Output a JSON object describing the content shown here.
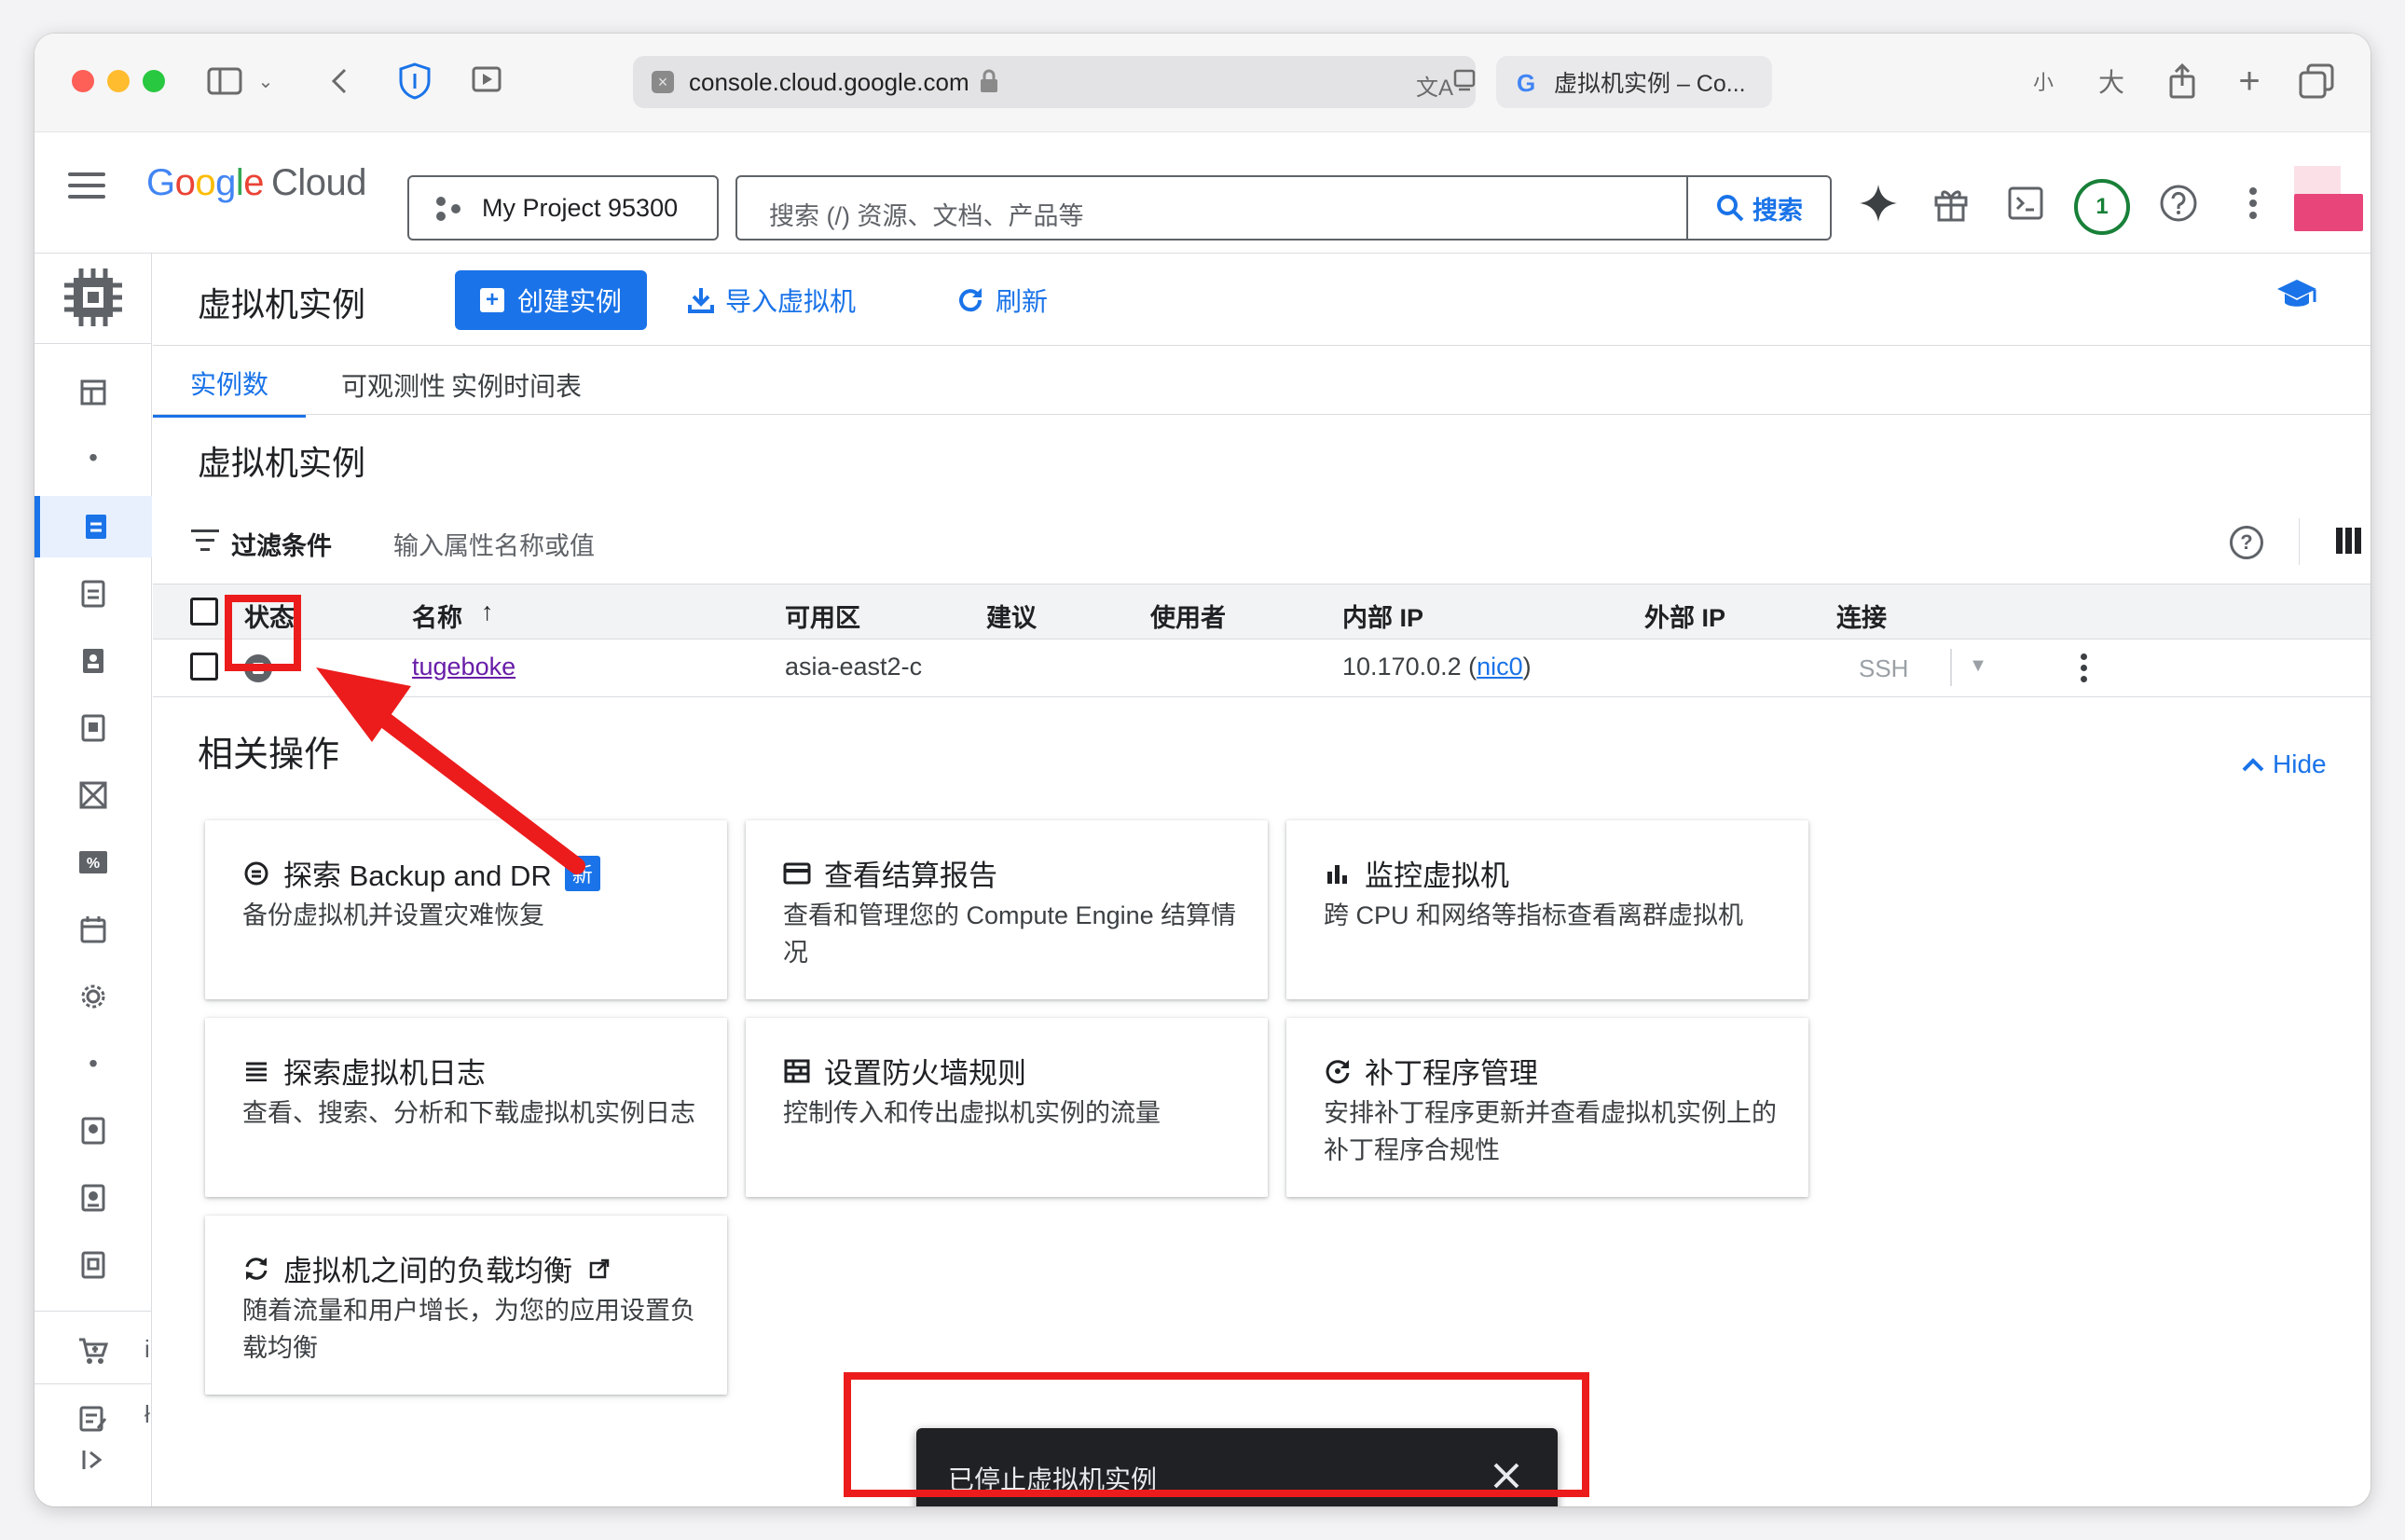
{
  "browser": {
    "url": "console.cloud.google.com",
    "tab_title": "虚拟机实例 – Co...",
    "text_small": "小",
    "text_large": "大"
  },
  "header": {
    "logo_google": "Google",
    "logo_cloud": "Cloud",
    "project": "My Project 95300",
    "search_placeholder": "搜索 (/) 资源、文档、产品等",
    "search_button": "搜索",
    "notifications_count": "1"
  },
  "toolbar": {
    "title": "虚拟机实例",
    "create_label": "创建实例",
    "import_label": "导入虚拟机",
    "refresh_label": "刷新"
  },
  "tabs": [
    {
      "label": "实例数",
      "active": true
    },
    {
      "label": "可观测性",
      "active": false
    },
    {
      "label": "实例时间表",
      "active": false
    }
  ],
  "section_title": "虚拟机实例",
  "filter": {
    "label": "过滤条件",
    "placeholder": "输入属性名称或值"
  },
  "table": {
    "headers": [
      "状态",
      "名称",
      "可用区",
      "建议",
      "使用者",
      "内部 IP",
      "外部 IP",
      "连接"
    ],
    "sort_indicator": "↑",
    "rows": [
      {
        "status": "stopped",
        "name": "tugeboke",
        "zone": "asia-east2-c",
        "internal_ip": "10.170.0.2",
        "nic_open": "(",
        "nic": "nic0",
        "nic_close": ")",
        "connect": "SSH"
      }
    ]
  },
  "related": {
    "title": "相关操作",
    "hide_label": "Hide",
    "cards": [
      {
        "title": "探索 Backup and DR",
        "badge": "新",
        "desc": "备份虚拟机并设置灾难恢复",
        "icon": "backup-icon"
      },
      {
        "title": "查看结算报告",
        "desc": "查看和管理您的 Compute Engine 结算情况",
        "icon": "billing-icon"
      },
      {
        "title": "监控虚拟机",
        "desc": "跨 CPU 和网络等指标查看离群虚拟机",
        "icon": "monitoring-icon"
      },
      {
        "title": "探索虚拟机日志",
        "desc": "查看、搜索、分析和下载虚拟机实例日志",
        "icon": "logs-icon"
      },
      {
        "title": "设置防火墙规则",
        "desc": "控制传入和传出虚拟机实例的流量",
        "icon": "firewall-icon"
      },
      {
        "title": "补丁程序管理",
        "desc": "安排补丁程序更新并查看虚拟机实例上的补丁程序合规性",
        "icon": "patch-icon"
      },
      {
        "title": "虚拟机之间的负载均衡",
        "desc": "随着流量和用户增长，为您的应用设置负载均衡",
        "icon": "load-balance-icon"
      }
    ]
  },
  "snackbar": {
    "message": "已停止虚拟机实例"
  },
  "nav_truncated": [
    "i",
    "ł"
  ],
  "colors": {
    "accent": "#1a73e8",
    "annotation_red": "#ec1c1c",
    "visited_link": "#681da8"
  }
}
